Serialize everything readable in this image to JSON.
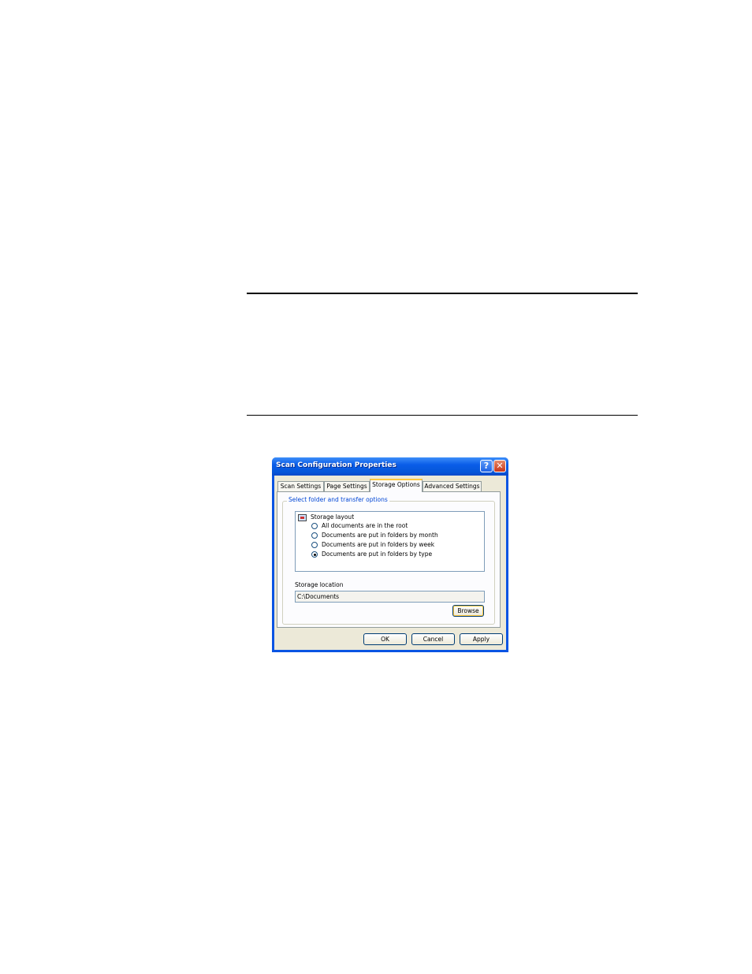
{
  "window": {
    "title": "Scan Configuration Properties",
    "help_glyph": "?",
    "close_glyph": "✕"
  },
  "tabs": [
    {
      "label": "Scan Settings"
    },
    {
      "label": "Page Settings"
    },
    {
      "label": "Storage Options"
    },
    {
      "label": "Advanced Settings"
    }
  ],
  "active_tab": "Storage Options",
  "group": {
    "label": "Select folder and transfer options",
    "tree_label": "Storage layout",
    "options": [
      {
        "label": "All documents are in the root",
        "checked": false
      },
      {
        "label": "Documents are put in folders by month",
        "checked": false
      },
      {
        "label": "Documents are put in folders by week",
        "checked": false
      },
      {
        "label": "Documents are put in folders by type",
        "checked": true
      }
    ],
    "location_label": "Storage location",
    "location_value": "C:\\Documents",
    "browse_label": "Browse"
  },
  "buttons": {
    "ok": "OK",
    "cancel": "Cancel",
    "apply": "Apply"
  },
  "colors": {
    "titlebar": "#0a5de8",
    "dialog_bg": "#ece9d8",
    "group_label": "#0046d5"
  }
}
